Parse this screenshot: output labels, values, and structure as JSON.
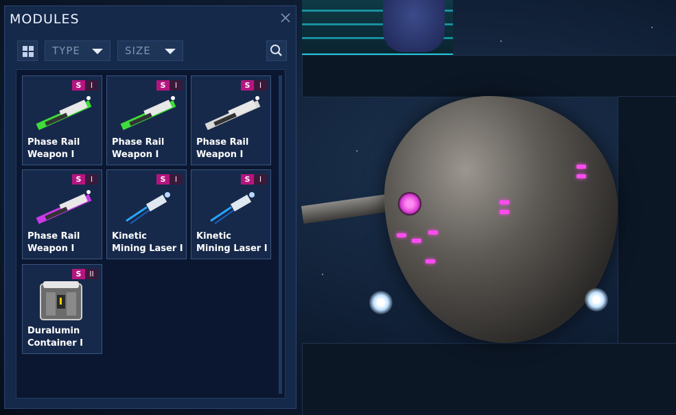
{
  "panel": {
    "title": "MODULES",
    "toolbar": {
      "type_label": "TYPE",
      "size_label": "SIZE"
    },
    "items": [
      {
        "name": "Phase Rail Weapon I",
        "size": "S",
        "tier": "I",
        "icon": "phase-rail-green-icon",
        "accent": "#3fdc3a"
      },
      {
        "name": "Phase Rail Weapon I",
        "size": "S",
        "tier": "I",
        "icon": "phase-rail-green-icon",
        "accent": "#3fdc3a"
      },
      {
        "name": "Phase Rail Weapon I",
        "size": "S",
        "tier": "I",
        "icon": "phase-rail-silver-icon",
        "accent": "#d8d8d8"
      },
      {
        "name": "Phase Rail Weapon I",
        "size": "S",
        "tier": "I",
        "icon": "phase-rail-purple-icon",
        "accent": "#c83ae8"
      },
      {
        "name": "Kinetic Mining Laser I",
        "size": "S",
        "tier": "I",
        "icon": "mining-laser-icon",
        "accent": "#2aa6ff"
      },
      {
        "name": "Kinetic Mining Laser I",
        "size": "S",
        "tier": "I",
        "icon": "mining-laser-icon",
        "accent": "#2aa6ff"
      },
      {
        "name": "Duralumin Container I",
        "size": "S",
        "tier": "II",
        "icon": "container-icon",
        "accent": "#d6d6d6"
      }
    ]
  },
  "colors": {
    "panel_bg": "#15294a",
    "size_badge": "#b6157f",
    "engine_glow": "#ff4cf0"
  }
}
